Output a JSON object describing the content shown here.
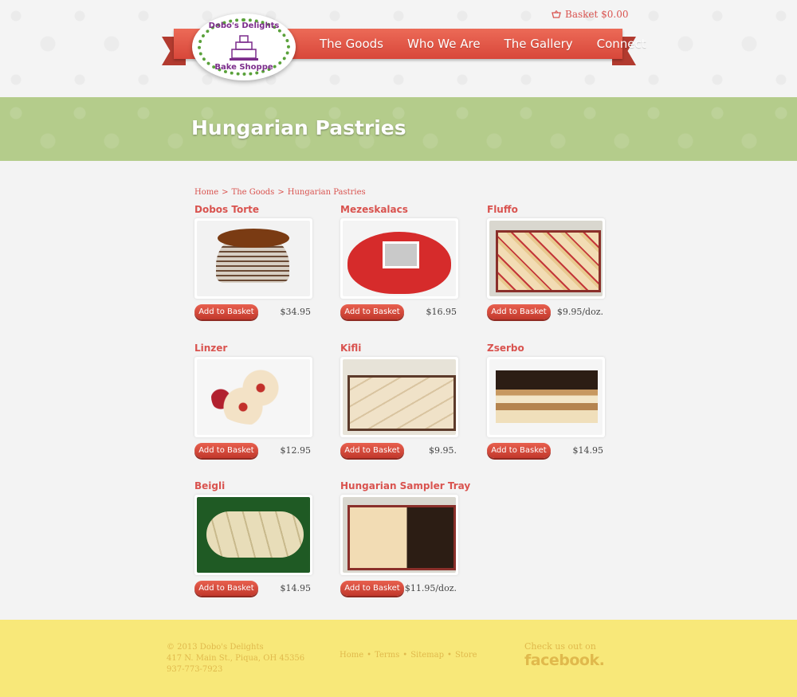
{
  "header": {
    "basket_label": "Basket $0.00",
    "logo_top": "Dobo's Delights",
    "logo_bottom": "Bake Shoppe",
    "nav": [
      "The Goods",
      "Who We Are",
      "The Gallery",
      "Connect"
    ]
  },
  "page": {
    "title": "Hungarian Pastries",
    "breadcrumb": [
      "Home",
      "The Goods",
      "Hungarian Pastries"
    ],
    "breadcrumb_separator": ">"
  },
  "products": [
    {
      "name": "Dobos Torte",
      "price": "$34.95",
      "button": "Add to Basket",
      "image_icon": "dobos-torte-photo"
    },
    {
      "name": "Mezeskalacs",
      "price": "$16.95",
      "button": "Add to Basket",
      "image_icon": "mezeskalacs-photo"
    },
    {
      "name": "Fluffo",
      "price": "$9.95/doz.",
      "button": "Add to Basket",
      "image_icon": "fluffo-photo"
    },
    {
      "name": "Linzer",
      "price": "$12.95",
      "button": "Add to Basket",
      "image_icon": "linzer-photo"
    },
    {
      "name": "Kifli",
      "price": "$9.95.",
      "button": "Add to Basket",
      "image_icon": "kifli-photo"
    },
    {
      "name": "Zserbo",
      "price": "$14.95",
      "button": "Add to Basket",
      "image_icon": "zserbo-photo"
    },
    {
      "name": "Beigli",
      "price": "$14.95",
      "button": "Add to Basket",
      "image_icon": "beigli-photo"
    },
    {
      "name": "Hungarian Sampler Tray",
      "price": "$11.95/doz.",
      "button": "Add to Basket",
      "image_icon": "sampler-tray-photo"
    }
  ],
  "footer": {
    "copyright": "© 2013 Dobo's Delights",
    "address": "417 N. Main St., Piqua, OH 45356",
    "phone": "937-773-7923",
    "links": [
      "Home",
      "Terms",
      "Sitemap",
      "Store"
    ],
    "link_separator": "•",
    "social_caption": "Check us out on",
    "facebook_label": "facebook."
  },
  "colors": {
    "accent_red": "#d9534f",
    "header_green": "#b4cc8b",
    "footer_yellow": "#f8e879",
    "footer_text": "#e0b94c"
  }
}
